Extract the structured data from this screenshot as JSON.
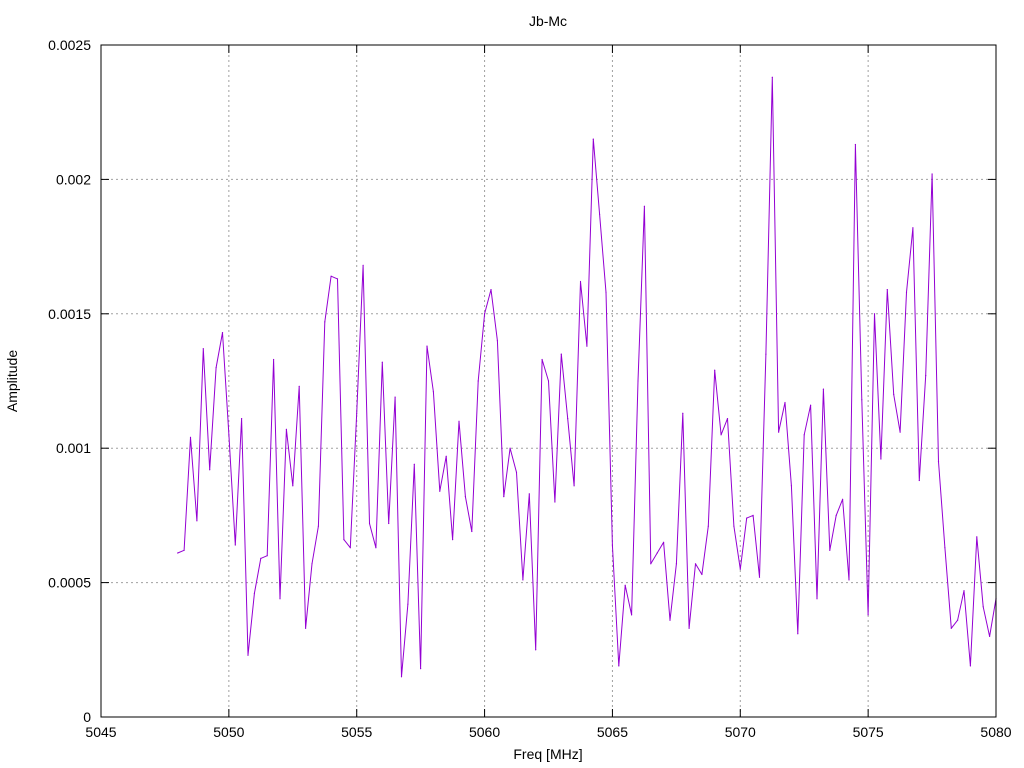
{
  "chart_data": {
    "type": "line",
    "title": "Jb-Mc",
    "xlabel": "Freq [MHz]",
    "ylabel": "Amplitude",
    "xlim": [
      5045,
      5080
    ],
    "ylim": [
      0,
      0.0025
    ],
    "grid": true,
    "legend": "none",
    "x_ticks": [
      "5045",
      "5050",
      "5055",
      "5060",
      "5065",
      "5070",
      "5075",
      "5080"
    ],
    "y_ticks": [
      "0",
      "0.0005",
      "0.001",
      "0.0015",
      "0.002",
      "0.0025"
    ],
    "series": [
      {
        "color": "#9400d3",
        "x": [
          5048.0,
          5048.25,
          5048.5,
          5048.75,
          5049.0,
          5049.25,
          5049.5,
          5049.75,
          5050.0,
          5050.25,
          5050.5,
          5050.75,
          5051.0,
          5051.25,
          5051.5,
          5051.75,
          5052.0,
          5052.25,
          5052.5,
          5052.75,
          5053.0,
          5053.25,
          5053.5,
          5053.75,
          5054.0,
          5054.25,
          5054.5,
          5054.75,
          5055.0,
          5055.25,
          5055.5,
          5055.75,
          5056.0,
          5056.25,
          5056.5,
          5056.75,
          5057.0,
          5057.25,
          5057.5,
          5057.75,
          5058.0,
          5058.25,
          5058.5,
          5058.75,
          5059.0,
          5059.25,
          5059.5,
          5059.75,
          5060.0,
          5060.25,
          5060.5,
          5060.75,
          5061.0,
          5061.25,
          5061.5,
          5061.75,
          5062.0,
          5062.25,
          5062.5,
          5062.75,
          5063.0,
          5063.25,
          5063.5,
          5063.75,
          5064.0,
          5064.25,
          5064.5,
          5064.75,
          5065.0,
          5065.25,
          5065.5,
          5065.75,
          5066.0,
          5066.25,
          5066.5,
          5066.75,
          5067.0,
          5067.25,
          5067.5,
          5067.75,
          5068.0,
          5068.25,
          5068.5,
          5068.75,
          5069.0,
          5069.25,
          5069.5,
          5069.75,
          5070.0,
          5070.25,
          5070.5,
          5070.75,
          5071.0,
          5071.25,
          5071.5,
          5071.75,
          5072.0,
          5072.25,
          5072.5,
          5072.75,
          5073.0,
          5073.25,
          5073.5,
          5073.75,
          5074.0,
          5074.25,
          5074.5,
          5074.75,
          5075.0,
          5075.25,
          5075.5,
          5075.75,
          5076.0,
          5076.25,
          5076.5,
          5076.75,
          5077.0,
          5077.25,
          5077.5,
          5077.75,
          5078.0,
          5078.25,
          5078.5,
          5078.75,
          5079.0,
          5079.25,
          5079.5,
          5079.75,
          5080.0
        ],
        "y": [
          0.00061,
          0.00062,
          0.00104,
          0.00073,
          0.00137,
          0.00092,
          0.0013,
          0.00143,
          0.00105,
          0.00064,
          0.00111,
          0.00023,
          0.00046,
          0.00059,
          0.0006,
          0.00133,
          0.00044,
          0.00107,
          0.00086,
          0.00123,
          0.00033,
          0.00057,
          0.00071,
          0.00147,
          0.00164,
          0.00163,
          0.00066,
          0.00063,
          0.00113,
          0.00168,
          0.00072,
          0.00063,
          0.00132,
          0.00072,
          0.00119,
          0.00015,
          0.00042,
          0.00094,
          0.00018,
          0.00138,
          0.00121,
          0.00084,
          0.00097,
          0.00066,
          0.0011,
          0.00082,
          0.00069,
          0.00125,
          0.0015,
          0.00159,
          0.0014,
          0.00082,
          0.001,
          0.00091,
          0.00051,
          0.00083,
          0.00025,
          0.00133,
          0.00125,
          0.0008,
          0.00135,
          0.00111,
          0.00086,
          0.00162,
          0.00138,
          0.00215,
          0.00187,
          0.00158,
          0.00064,
          0.00019,
          0.00049,
          0.00038,
          0.00125,
          0.0019,
          0.00057,
          0.00061,
          0.00065,
          0.00036,
          0.00057,
          0.00113,
          0.00033,
          0.00057,
          0.00053,
          0.00071,
          0.00129,
          0.00105,
          0.00111,
          0.00071,
          0.00055,
          0.00074,
          0.00075,
          0.00052,
          0.00135,
          0.00238,
          0.00106,
          0.00117,
          0.00086,
          0.00031,
          0.00105,
          0.00116,
          0.00044,
          0.00122,
          0.00062,
          0.00075,
          0.00081,
          0.00051,
          0.00213,
          0.00118,
          0.00038,
          0.0015,
          0.00096,
          0.00159,
          0.0012,
          0.00106,
          0.00158,
          0.00182,
          0.00088,
          0.00127,
          0.00202,
          0.00095,
          0.00063,
          0.00033,
          0.00036,
          0.00047,
          0.00019,
          0.00067,
          0.00041,
          0.0003,
          0.00044
        ]
      }
    ]
  }
}
